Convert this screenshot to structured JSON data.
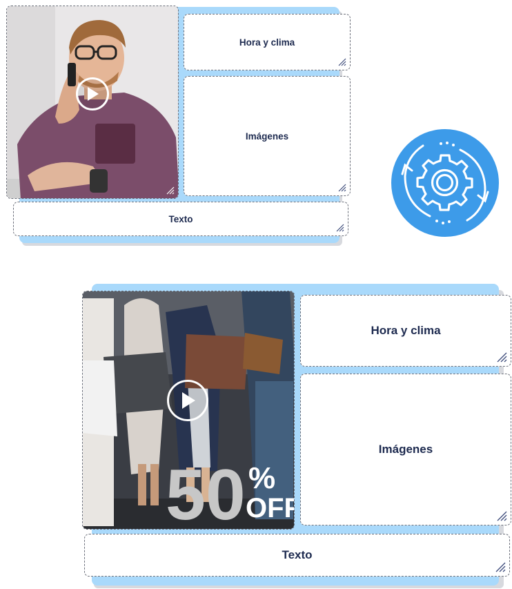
{
  "layout_small": {
    "zone_time_weather": "Hora y clima",
    "zone_images": "Imágenes",
    "zone_text": "Texto"
  },
  "layout_large": {
    "zone_time_weather": "Hora y clima",
    "zone_images": "Imágenes",
    "zone_text": "Texto",
    "promo": {
      "number": "50",
      "percent": "%",
      "off": "OFF"
    }
  },
  "icons": {
    "play": "play-icon",
    "resize": "resize-grip-icon",
    "sync": "sync-gear-icon"
  },
  "colors": {
    "panel_blue": "#a9d9fb",
    "badge_blue": "#3d9be9",
    "text_navy": "#1d2a4f"
  }
}
